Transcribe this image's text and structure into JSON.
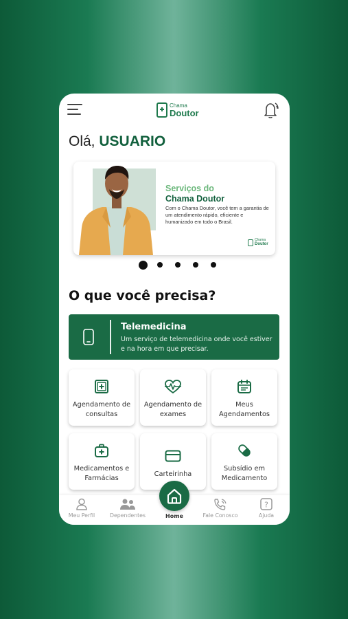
{
  "header": {
    "logo_small": "Chama",
    "logo_big": "Doutor"
  },
  "greeting": {
    "prefix": "Olá,",
    "name": "USUARIO"
  },
  "banner": {
    "title_line1": "Serviços do",
    "title_line2": "Chama Doutor",
    "text": "Com o Chama Doutor, você tem a garantia de um atendimento rápido, eficiente e humanizado em todo o Brasil.",
    "logo_small": "Chama",
    "logo_big": "Doutor",
    "slides_total": 5,
    "active_slide": 1
  },
  "section_title": "O que você precisa?",
  "telemedicina": {
    "title": "Telemedicina",
    "description": "Um serviço de telemedicina onde você estiver e na hora em que precisar."
  },
  "services": [
    {
      "label": "Agendamento de consultas",
      "icon": "medical-cross-icon"
    },
    {
      "label": "Agendamento de exames",
      "icon": "heartbeat-icon"
    },
    {
      "label": "Meus Agendamentos",
      "icon": "calendar-icon"
    },
    {
      "label": "Medicamentos e Farmácias",
      "icon": "first-aid-kit-icon"
    },
    {
      "label": "Carteirinha",
      "icon": "card-icon"
    },
    {
      "label": "Subsídio em Medicamento",
      "icon": "pill-icon"
    }
  ],
  "nav": {
    "profile": "Meu Perfil",
    "dependents": "Dependentes",
    "home": "Home",
    "contact": "Fale Conosco",
    "help": "Ajuda"
  },
  "colors": {
    "primary": "#1a6b45",
    "accent_light": "#6bb77b",
    "dark_text": "#12603d"
  }
}
